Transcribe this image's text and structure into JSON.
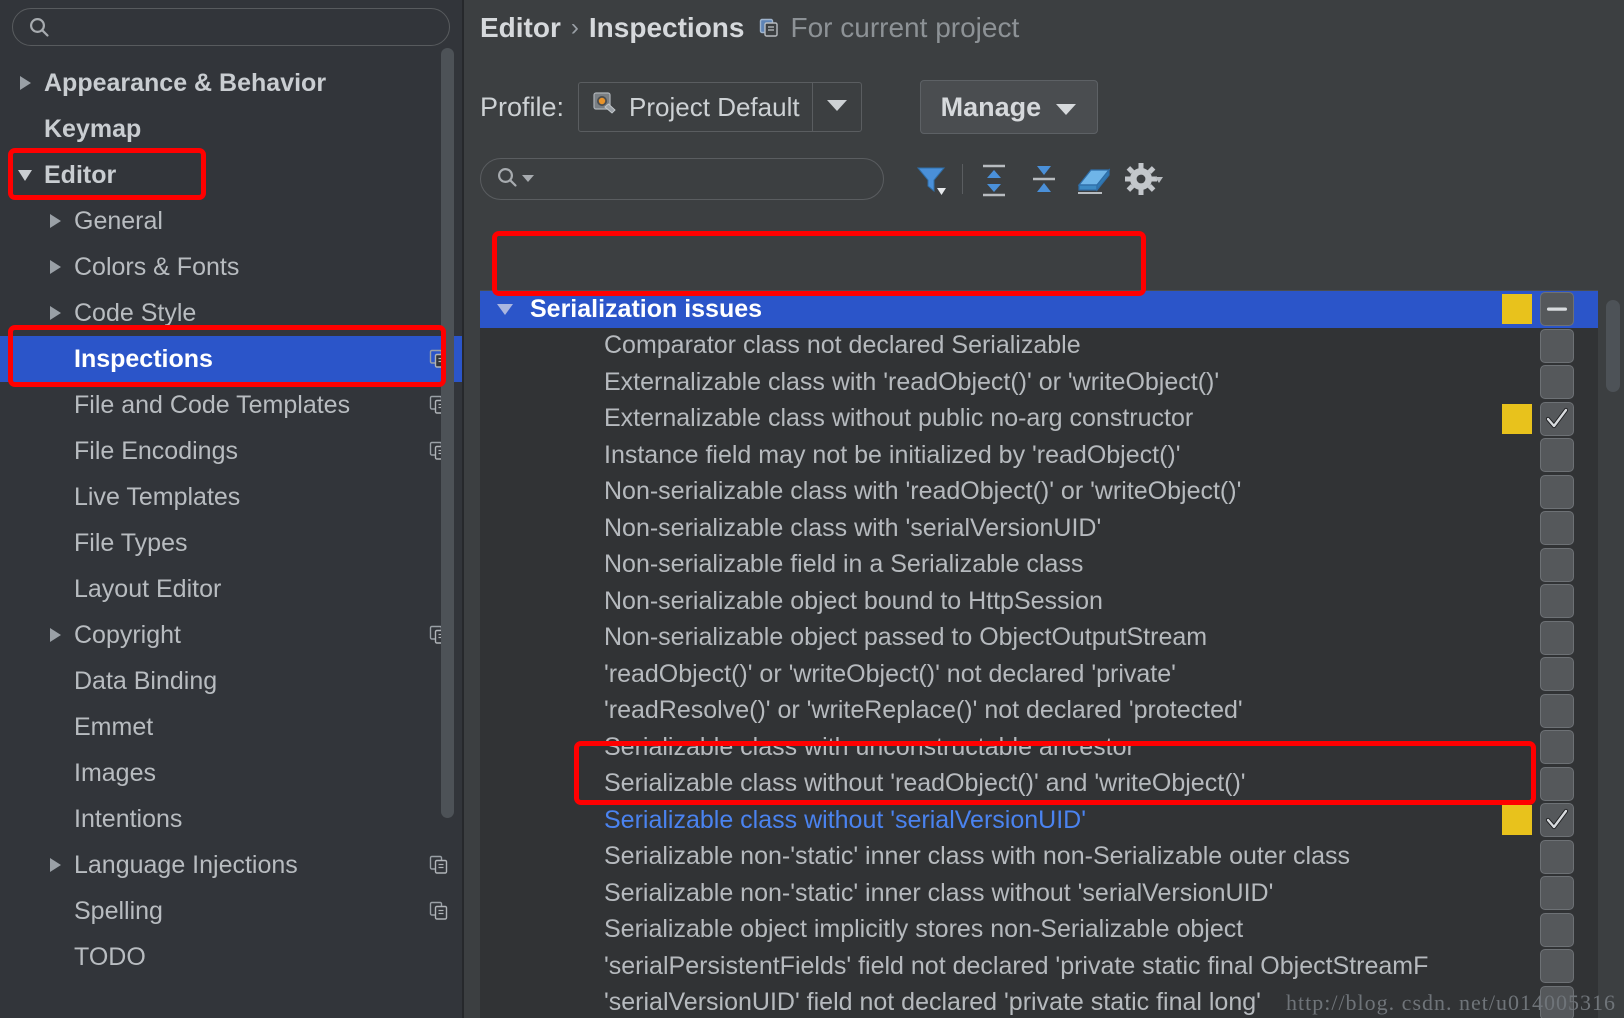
{
  "sidebar": {
    "search_placeholder": "",
    "search_value": "",
    "items": [
      {
        "label": "Appearance & Behavior",
        "depth": 0,
        "arrow": "right",
        "copy": false,
        "selected": false
      },
      {
        "label": "Keymap",
        "depth": 0,
        "arrow": "none",
        "copy": false,
        "selected": false
      },
      {
        "label": "Editor",
        "depth": 0,
        "arrow": "down",
        "copy": false,
        "selected": false
      },
      {
        "label": "General",
        "depth": 1,
        "arrow": "right",
        "copy": false,
        "selected": false
      },
      {
        "label": "Colors & Fonts",
        "depth": 1,
        "arrow": "right",
        "copy": false,
        "selected": false
      },
      {
        "label": "Code Style",
        "depth": 1,
        "arrow": "right",
        "copy": false,
        "selected": false
      },
      {
        "label": "Inspections",
        "depth": 1,
        "arrow": "none",
        "copy": true,
        "selected": true
      },
      {
        "label": "File and Code Templates",
        "depth": 1,
        "arrow": "none",
        "copy": true,
        "selected": false
      },
      {
        "label": "File Encodings",
        "depth": 1,
        "arrow": "none",
        "copy": true,
        "selected": false
      },
      {
        "label": "Live Templates",
        "depth": 1,
        "arrow": "none",
        "copy": false,
        "selected": false
      },
      {
        "label": "File Types",
        "depth": 1,
        "arrow": "none",
        "copy": false,
        "selected": false
      },
      {
        "label": "Layout Editor",
        "depth": 1,
        "arrow": "none",
        "copy": false,
        "selected": false
      },
      {
        "label": "Copyright",
        "depth": 1,
        "arrow": "right",
        "copy": true,
        "selected": false
      },
      {
        "label": "Data Binding",
        "depth": 1,
        "arrow": "none",
        "copy": false,
        "selected": false
      },
      {
        "label": "Emmet",
        "depth": 1,
        "arrow": "none",
        "copy": false,
        "selected": false
      },
      {
        "label": "Images",
        "depth": 1,
        "arrow": "none",
        "copy": false,
        "selected": false
      },
      {
        "label": "Intentions",
        "depth": 1,
        "arrow": "none",
        "copy": false,
        "selected": false
      },
      {
        "label": "Language Injections",
        "depth": 1,
        "arrow": "right",
        "copy": true,
        "selected": false
      },
      {
        "label": "Spelling",
        "depth": 1,
        "arrow": "none",
        "copy": true,
        "selected": false
      },
      {
        "label": "TODO",
        "depth": 1,
        "arrow": "none",
        "copy": false,
        "selected": false
      }
    ]
  },
  "header": {
    "crumb_1": "Editor",
    "crumb_sep": "›",
    "crumb_2": "Inspections",
    "scope_label": "For current project",
    "scope_icon": "copy-icon"
  },
  "profile": {
    "label": "Profile:",
    "value": "Project Default",
    "value_icon": "profile-gear-wrench-icon",
    "dropdown_icon": "chevron-down-icon",
    "manage_label": "Manage",
    "manage_icon": "chevron-down-icon"
  },
  "toolbar": {
    "search_placeholder": "",
    "search_value": "",
    "search_icon": "search-icon",
    "buttons": [
      {
        "name": "filter-icon",
        "label": "Filter inspections"
      },
      {
        "name": "expand-all-icon",
        "label": "Expand all"
      },
      {
        "name": "collapse-all-icon",
        "label": "Collapse all"
      },
      {
        "name": "reset-eraser-icon",
        "label": "Reset to default"
      },
      {
        "name": "gear-icon",
        "label": "Settings"
      }
    ]
  },
  "inspections": {
    "group": {
      "label": "Serialization issues",
      "expanded": true,
      "severity": "warning",
      "severity_color": "#e8c21c",
      "checkbox": "indeterminate"
    },
    "rows": [
      {
        "label": "Comparator class not declared Serializable",
        "severity": false,
        "checkbox": "unchecked",
        "modified": false
      },
      {
        "label": "Externalizable class with 'readObject()' or 'writeObject()'",
        "severity": false,
        "checkbox": "unchecked",
        "modified": false
      },
      {
        "label": "Externalizable class without public no-arg constructor",
        "severity": true,
        "checkbox": "checked",
        "modified": false
      },
      {
        "label": "Instance field may not be initialized by 'readObject()'",
        "severity": false,
        "checkbox": "unchecked",
        "modified": false
      },
      {
        "label": "Non-serializable class with 'readObject()' or 'writeObject()'",
        "severity": false,
        "checkbox": "unchecked",
        "modified": false
      },
      {
        "label": "Non-serializable class with 'serialVersionUID'",
        "severity": false,
        "checkbox": "unchecked",
        "modified": false
      },
      {
        "label": "Non-serializable field in a Serializable class",
        "severity": false,
        "checkbox": "unchecked",
        "modified": false
      },
      {
        "label": "Non-serializable object bound to HttpSession",
        "severity": false,
        "checkbox": "unchecked",
        "modified": false
      },
      {
        "label": "Non-serializable object passed to ObjectOutputStream",
        "severity": false,
        "checkbox": "unchecked",
        "modified": false
      },
      {
        "label": "'readObject()' or 'writeObject()' not declared 'private'",
        "severity": false,
        "checkbox": "unchecked",
        "modified": false
      },
      {
        "label": "'readResolve()' or 'writeReplace()' not declared 'protected'",
        "severity": false,
        "checkbox": "unchecked",
        "modified": false
      },
      {
        "label": "Serializable class with unconstructable ancestor",
        "severity": false,
        "checkbox": "unchecked",
        "modified": false
      },
      {
        "label": "Serializable class without 'readObject()' and 'writeObject()'",
        "severity": false,
        "checkbox": "unchecked",
        "modified": false
      },
      {
        "label": "Serializable class without 'serialVersionUID'",
        "severity": true,
        "checkbox": "checked",
        "modified": true
      },
      {
        "label": "Serializable non-'static' inner class with non-Serializable outer class",
        "severity": false,
        "checkbox": "unchecked",
        "modified": false
      },
      {
        "label": "Serializable non-'static' inner class without 'serialVersionUID'",
        "severity": false,
        "checkbox": "unchecked",
        "modified": false
      },
      {
        "label": "Serializable object implicitly stores non-Serializable object",
        "severity": false,
        "checkbox": "unchecked",
        "modified": false
      },
      {
        "label": "'serialPersistentFields' field not declared 'private static final ObjectStreamF",
        "severity": false,
        "checkbox": "unchecked",
        "modified": false
      },
      {
        "label": "'serialVersionUID' field not declared 'private static final long'",
        "severity": false,
        "checkbox": "unchecked",
        "modified": false
      }
    ]
  },
  "annotations": {
    "color": "#ff0000",
    "highlights": [
      "editor-node",
      "inspections-node",
      "serialization-issues-group",
      "serializable-class-without-serialversionuid-row"
    ]
  },
  "watermark": "http://blog. csdn. net/u014005316"
}
